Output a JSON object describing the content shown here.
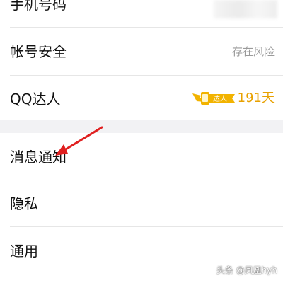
{
  "settings": {
    "phone_label": "手机号码",
    "account_security_label": "帐号安全",
    "account_security_status": "存在风险",
    "qq_expert_label": "QQ达人",
    "qq_expert_badge": "达人",
    "qq_expert_days": "191天",
    "notifications_label": "消息通知",
    "privacy_label": "隐私",
    "general_label": "通用"
  },
  "watermark": "头条 @凤凰hyh",
  "colors": {
    "badge_gold": "#f2b300",
    "arrow_red": "#e02020"
  }
}
